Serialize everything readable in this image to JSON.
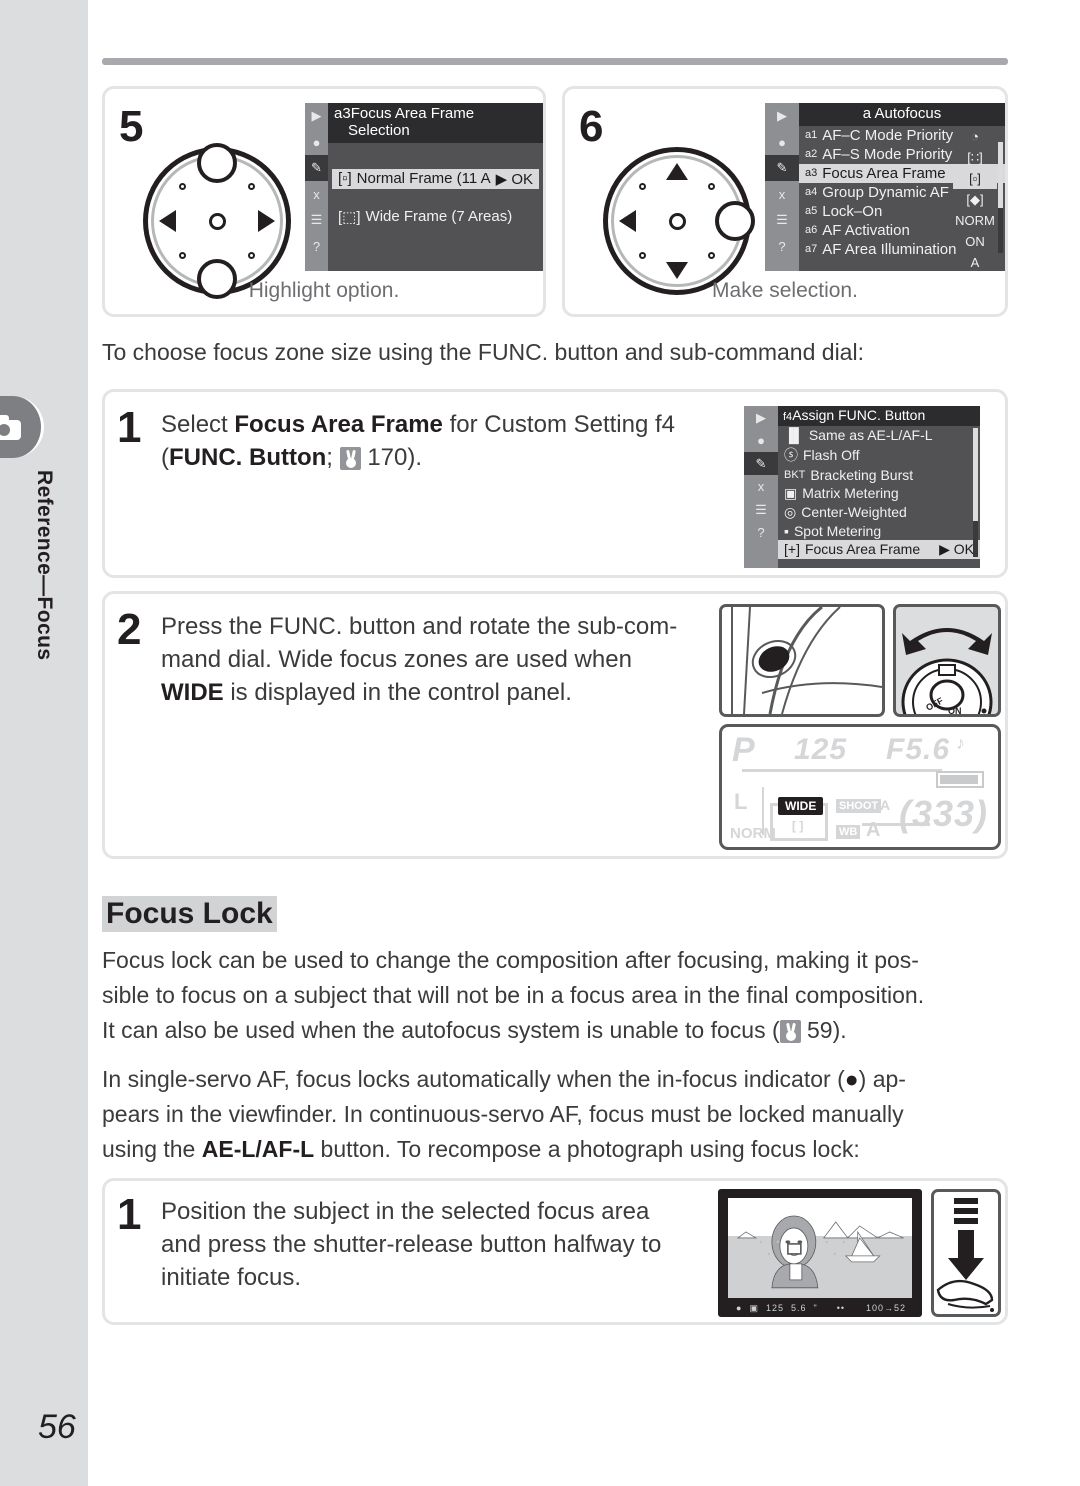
{
  "page": {
    "number": "56",
    "side_tab_label": "Reference—Focus",
    "side_tab_icon": "camera-icon"
  },
  "step5": {
    "number": "5",
    "caption": "Highlight option.",
    "menu": {
      "title_line1": "a3Focus Area Frame",
      "title_line2": "Selection",
      "title_prefix": "a3",
      "title_text": "Focus Area Frame Selection",
      "rows": [
        {
          "icon": "[▫]",
          "label": "Normal Frame (11 A",
          "trailing": "▶ OK",
          "selected": true
        },
        {
          "icon": "[⬚]",
          "label": "Wide Frame (7 Areas)",
          "trailing": "",
          "selected": false
        }
      ],
      "side_icons": [
        "playback-icon",
        "shooting-menu-icon",
        "custom-settings-pencil-icon",
        "setup-wrench-icon",
        "recent-settings-icon",
        "help-question-icon"
      ]
    }
  },
  "step6": {
    "number": "6",
    "caption": "Make selection.",
    "menu": {
      "title": "a Autofocus",
      "rows": [
        {
          "prefix": "a1",
          "label": "AF–C Mode Priority",
          "value": "◔",
          "selected": false
        },
        {
          "prefix": "a2",
          "label": "AF–S Mode Priority",
          "value": "[∷]",
          "selected": false
        },
        {
          "prefix": "a3",
          "label": "Focus Area Frame",
          "value": "[▫]",
          "selected": true
        },
        {
          "prefix": "a4",
          "label": "Group Dynamic AF",
          "value": "[◆]",
          "selected": false
        },
        {
          "prefix": "a5",
          "label": "Lock–On",
          "value": "NORM",
          "selected": false
        },
        {
          "prefix": "a6",
          "label": "AF Activation",
          "value": "ON",
          "selected": false
        },
        {
          "prefix": "a7",
          "label": "AF Area Illumination",
          "value": "A",
          "selected": false
        }
      ]
    }
  },
  "intro_line": "To choose focus zone size using the FUNC. button and sub-command dial:",
  "func_step1": {
    "number": "1",
    "text_a": "Select ",
    "text_bold1": "Focus Area Frame",
    "text_b": " for Custom Setting f4",
    "text_c": "(",
    "text_bold2": "FUNC. Button",
    "text_d": "; ",
    "page_ref": "170",
    "text_e": ").",
    "menu": {
      "title_prefix": "f4",
      "title": "Assign FUNC. Button",
      "rows": [
        {
          "icon": "▐▌",
          "icon_name": "ae-l-af-l-icon",
          "label": "Same as AE-L/AF-L",
          "selected": false,
          "trailing": ""
        },
        {
          "icon": "ⓢ",
          "icon_name": "flash-off-icon",
          "label": "Flash Off",
          "selected": false,
          "trailing": ""
        },
        {
          "icon": "BKT",
          "icon_name": "bracketing-icon",
          "label": "Bracketing Burst",
          "selected": false,
          "trailing": ""
        },
        {
          "icon": "▣",
          "icon_name": "matrix-metering-icon",
          "label": "Matrix Metering",
          "selected": false,
          "trailing": ""
        },
        {
          "icon": "◎",
          "icon_name": "center-weighted-icon",
          "label": "Center-Weighted",
          "selected": false,
          "trailing": ""
        },
        {
          "icon": "▪",
          "icon_name": "spot-metering-icon",
          "label": "Spot Metering",
          "selected": false,
          "trailing": ""
        },
        {
          "icon": "[+]",
          "icon_name": "focus-area-frame-icon",
          "label": "Focus Area Frame",
          "selected": true,
          "trailing": "▶ OK"
        }
      ]
    }
  },
  "func_step2": {
    "number": "2",
    "line1": "Press the FUNC. button and rotate the sub-com-",
    "line2": "mand dial.  Wide focus zones are used when",
    "line3_bold": "WIDE",
    "line3": " is displayed in the control panel.",
    "illustration_left": "func-button-photo",
    "illustration_right": "sub-command-dial-photo",
    "dial_labels": {
      "off": "OFF",
      "on": "ON"
    },
    "control_panel": {
      "mode": "P",
      "shutter_speed": "125",
      "aperture": "F5.6",
      "beep": "♪",
      "battery": "battery-full-icon",
      "image_size": "L",
      "image_quality": "NORM",
      "focus_mode_badge": "WIDE",
      "focus_bracket": "[ ]",
      "shoot_label": "SHOOT",
      "shoot_value": "A",
      "wb_label": "WB",
      "wb_value": "A",
      "frames_remaining": "(333)"
    }
  },
  "focus_lock": {
    "heading": "Focus Lock",
    "para1_line1": "Focus lock can be used to change the composition after focusing, making it pos-",
    "para1_line2": "sible to focus on a subject that will not be in a focus area in the final composition.",
    "para1_line3a": "It can also be used when the autofocus system is unable to focus (",
    "para1_pageref": "59",
    "para1_line3b": ").",
    "para2_line1a": "In single-servo AF, focus locks automatically when the in-focus indicator (",
    "para2_indicator": "●",
    "para2_line1b": ") ap-",
    "para2_line2": "pears in the viewfinder.  In continuous-servo AF, focus must be locked manually",
    "para2_line3a": "using the ",
    "para2_bold": "AE-L/AF-L",
    "para2_line3b": " button.  To recompose a photograph using focus lock:"
  },
  "lock_step1": {
    "number": "1",
    "line1": "Position  the  subject  in  the  selected  focus  area",
    "line2": "and  press  the  shutter-release  button  halfway  to",
    "line3": "initiate focus.",
    "viewfinder": {
      "in_focus_indicator": "●",
      "metering": "▣",
      "shutter_speed": "125",
      "aperture": "5.6",
      "exposure_mode": "ʺ",
      "exposure_bar": "••",
      "frame_count": "100→52"
    },
    "illustration_right": "shutter-release-halfway-photo"
  }
}
